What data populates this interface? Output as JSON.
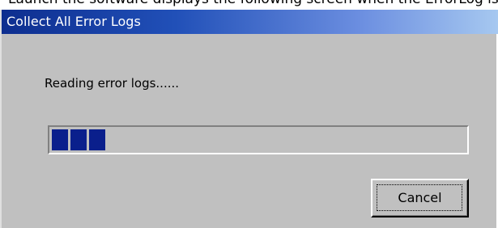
{
  "window": {
    "title": "Collect All Error Logs",
    "caption_above": "Launch the software displays the following screen when the ErrorLog is collected."
  },
  "dialog": {
    "message": "Reading error logs......",
    "progress": {
      "value": 0.13,
      "style": "segmented-blocks",
      "fill_color": "#0a1f8c"
    },
    "buttons": {
      "cancel_label": "Cancel"
    }
  },
  "colors": {
    "title_gradient_start": "#0d2e8f",
    "title_gradient_end": "#a6c8f0",
    "dialog_face": "#c0c0c0"
  }
}
